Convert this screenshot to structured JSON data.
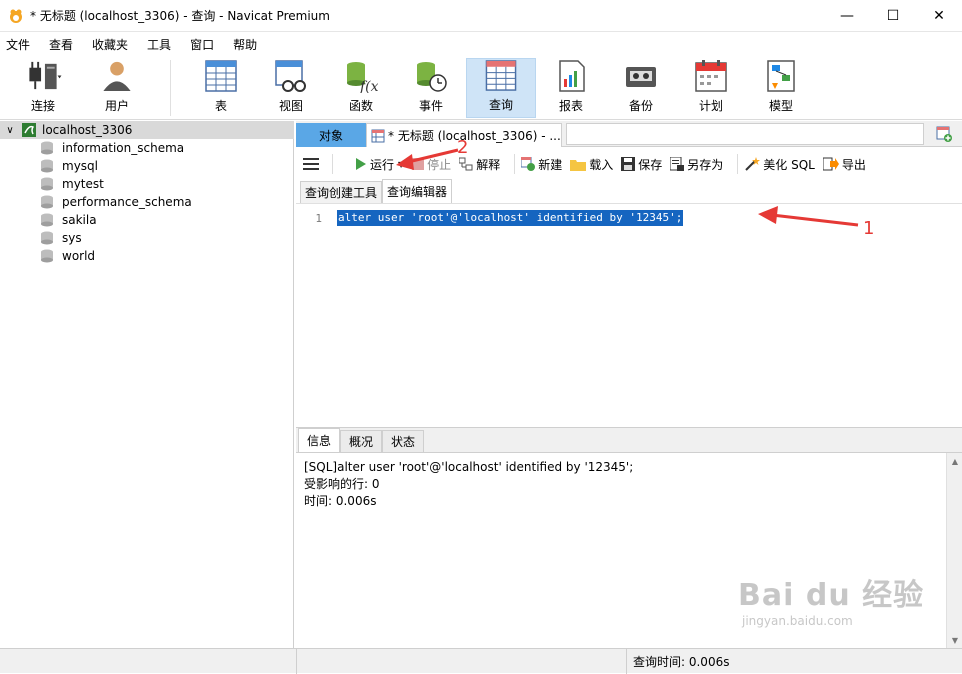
{
  "window": {
    "title": "* 无标题 (localhost_3306) - 查询 - Navicat Premium",
    "minimize_label": "—",
    "maximize_label": "☐",
    "close_label": "✕"
  },
  "menu": [
    "文件",
    "查看",
    "收藏夹",
    "工具",
    "窗口",
    "帮助"
  ],
  "toolbar": {
    "connect": "连接",
    "user": "用户",
    "table": "表",
    "view": "视图",
    "function": "函数",
    "event": "事件",
    "query": "查询",
    "report": "报表",
    "backup": "备份",
    "schedule": "计划",
    "model": "模型"
  },
  "tree": {
    "connection": "localhost_3306",
    "databases": [
      "information_schema",
      "mysql",
      "mytest",
      "performance_schema",
      "sakila",
      "sys",
      "world"
    ]
  },
  "tabs": {
    "objects": "对象",
    "query_tab": "* 无标题 (localhost_3306) - ..."
  },
  "query_toolbar": {
    "run": "运行",
    "stop": "停止",
    "explain": "解释",
    "new": "新建",
    "load": "载入",
    "save": "保存",
    "save_as": "另存为",
    "beautify": "美化 SQL",
    "export": "导出"
  },
  "subtabs": [
    "查询创建工具",
    "查询编辑器"
  ],
  "editor": {
    "line_number": "1",
    "code": "alter user 'root'@'localhost' identified by '12345';"
  },
  "message_tabs": [
    "信息",
    "概况",
    "状态"
  ],
  "messages": [
    "[SQL]alter user 'root'@'localhost' identified by '12345';",
    "受影响的行: 0",
    "时间: 0.006s"
  ],
  "status": {
    "query_time": "查询时间: 0.006s"
  },
  "annotations": {
    "label_1": "1",
    "label_2": "2"
  },
  "watermark": {
    "brand": "Bai du 经验",
    "url": "jingyan.baidu.com"
  },
  "colors": {
    "selection": "#1565c0",
    "active_tab": "#5aa7e6",
    "annotation": "#e53935"
  }
}
